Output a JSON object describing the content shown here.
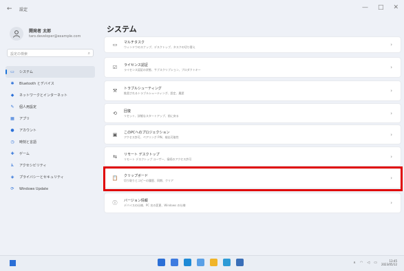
{
  "window": {
    "back_icon": "back-arrow-icon",
    "title": "設定",
    "controls": [
      "—",
      "□",
      "✕"
    ]
  },
  "profile": {
    "name": "開発者 太郎",
    "email": "taro.developer@example.com"
  },
  "search": {
    "placeholder": "設定の検索"
  },
  "sidebar": {
    "items": [
      {
        "label": "システム",
        "icon": "monitor-icon",
        "glyph": "▭",
        "active": true
      },
      {
        "label": "Bluetooth とデバイス",
        "icon": "bluetooth-icon",
        "glyph": "✱"
      },
      {
        "label": "ネットワークとインターネット",
        "icon": "network-icon",
        "glyph": "◆"
      },
      {
        "label": "個人用設定",
        "icon": "brush-icon",
        "glyph": "✎"
      },
      {
        "label": "アプリ",
        "icon": "apps-icon",
        "glyph": "▦"
      },
      {
        "label": "アカウント",
        "icon": "account-icon",
        "glyph": "●"
      },
      {
        "label": "時刻と言語",
        "icon": "clock-globe-icon",
        "glyph": "◷"
      },
      {
        "label": "ゲーム",
        "icon": "game-icon",
        "glyph": "✚"
      },
      {
        "label": "アクセシビリティ",
        "icon": "accessibility-icon",
        "glyph": "♿"
      },
      {
        "label": "プライバシーとセキュリティ",
        "icon": "shield-icon",
        "glyph": "◈"
      },
      {
        "label": "Windows Update",
        "icon": "update-icon",
        "glyph": "⟳"
      }
    ]
  },
  "main": {
    "title": "システム",
    "cards": [
      {
        "icon": "storage-icon",
        "glyph": "▭",
        "title": "マルチタスク",
        "sub": "ウィンドウのスナップ、デスクトップ、タスクの切り替え"
      },
      {
        "icon": "activation-icon",
        "glyph": "☑",
        "title": "ライセンス認証",
        "sub": "ライセンス認証の状態、サブスクリプション、プロダクトキー"
      },
      {
        "icon": "troubleshoot-icon",
        "glyph": "⚒",
        "title": "トラブルシューティング",
        "sub": "推奨されるトラブルシューティング、設定、履歴"
      },
      {
        "icon": "recovery-icon",
        "glyph": "⟲",
        "title": "回復",
        "sub": "リセット、詳細なスタートアップ、前に戻る"
      },
      {
        "icon": "projection-icon",
        "glyph": "▣",
        "title": "このPCへのプロジェクション",
        "sub": "アクセス許可、ペアリング PIN、検出可能性"
      },
      {
        "icon": "remote-desktop-icon",
        "glyph": "⇆",
        "title": "リモート デスクトップ",
        "sub": "リモート デスクトップ ユーザー、接続のアクセス許可"
      },
      {
        "icon": "clipboard-icon",
        "glyph": "📋",
        "title": "クリップボード",
        "sub": "切り取りとコピーの履歴、同期、クリア"
      },
      {
        "icon": "about-icon",
        "glyph": "ⓘ",
        "title": "バージョン情報",
        "sub": "デバイスの仕様、PC 名の変更、Windows の仕様"
      }
    ]
  },
  "taskbar": {
    "start_icon": "windows-start-icon",
    "apps": [
      "search-icon",
      "task-view-icon",
      "widgets-icon",
      "explorer-icon",
      "edge-icon",
      "store-icon",
      "settings-icon"
    ],
    "time": "13:45",
    "date": "2023/05/12"
  }
}
